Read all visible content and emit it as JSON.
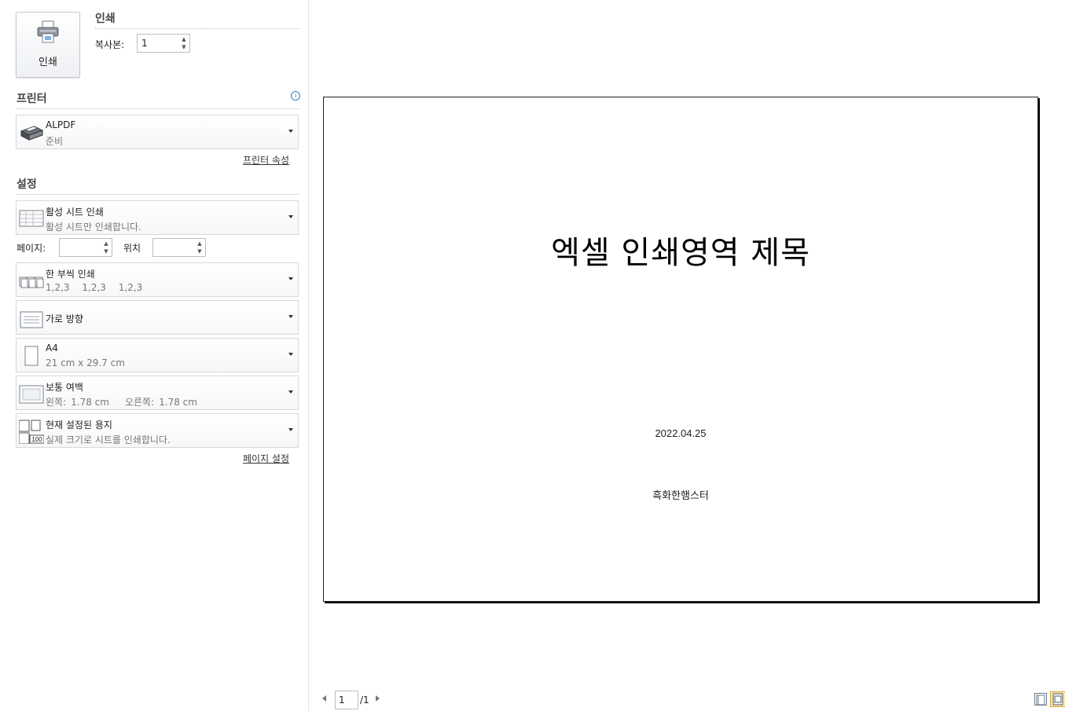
{
  "print": {
    "button_label": "인쇄",
    "section_title": "인쇄",
    "copies_label": "복사본:",
    "copies_value": "1"
  },
  "printer": {
    "section_title": "프린터",
    "name": "ALPDF",
    "status": "준비",
    "properties_link": "프린터 속성"
  },
  "settings": {
    "section_title": "설정",
    "scope": {
      "title": "활성 시트 인쇄",
      "subtitle": "활성 시트만 인쇄합니다."
    },
    "pages_label": "페이지:",
    "pages_value": "",
    "to_label": "위치",
    "to_value": "",
    "collate": {
      "title": "한 부씩 인쇄",
      "seq": [
        "1,2,3",
        "1,2,3",
        "1,2,3"
      ]
    },
    "orientation": {
      "title": "가로 방향"
    },
    "paper": {
      "title": "A4",
      "subtitle": "21 cm x 29.7 cm"
    },
    "margins": {
      "title": "보통 여백",
      "left_label": "왼쪽:",
      "left_value": "1.78 cm",
      "right_label": "오른쪽:",
      "right_value": "1.78 cm"
    },
    "scaling": {
      "title": "현재 설정된 용지",
      "subtitle": "실제 크기로 시트를 인쇄합니다.",
      "badge": "100"
    },
    "page_setup_link": "페이지 설정"
  },
  "preview": {
    "title": "엑셀 인쇄영역 제목",
    "date": "2022.04.25",
    "author": "흑화한햄스터"
  },
  "navigation": {
    "current_page": "1",
    "total": "/1"
  },
  "icons": {
    "printer": "printer-icon",
    "info": "info-icon",
    "prev": "prev-page-icon",
    "next": "next-page-icon"
  }
}
